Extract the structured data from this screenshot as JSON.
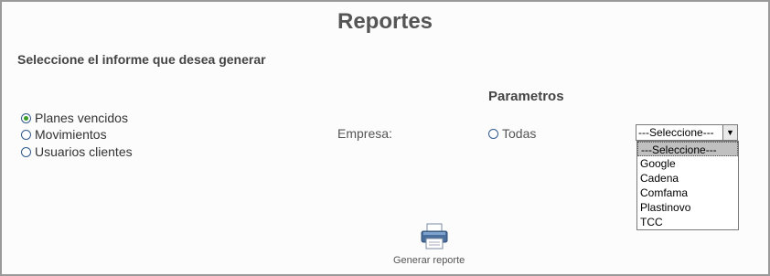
{
  "title": "Reportes",
  "subtitle": "Seleccione el informe que desea generar",
  "params_heading": "Parametros",
  "report_options": [
    {
      "label": "Planes vencidos",
      "checked": true
    },
    {
      "label": "Movimientos",
      "checked": false
    },
    {
      "label": "Usuarios clientes",
      "checked": false
    }
  ],
  "empresa_label": "Empresa:",
  "todas_label": "Todas",
  "select": {
    "value": "---Seleccione---",
    "options": [
      "---Seleccione---",
      "Google",
      "Cadena",
      "Comfama",
      "Plastinovo",
      "TCC"
    ]
  },
  "generate_label": "Generar reporte",
  "colors": {
    "radio_checked": "#3a9d2a",
    "radio_border": "#2f5a8c"
  }
}
